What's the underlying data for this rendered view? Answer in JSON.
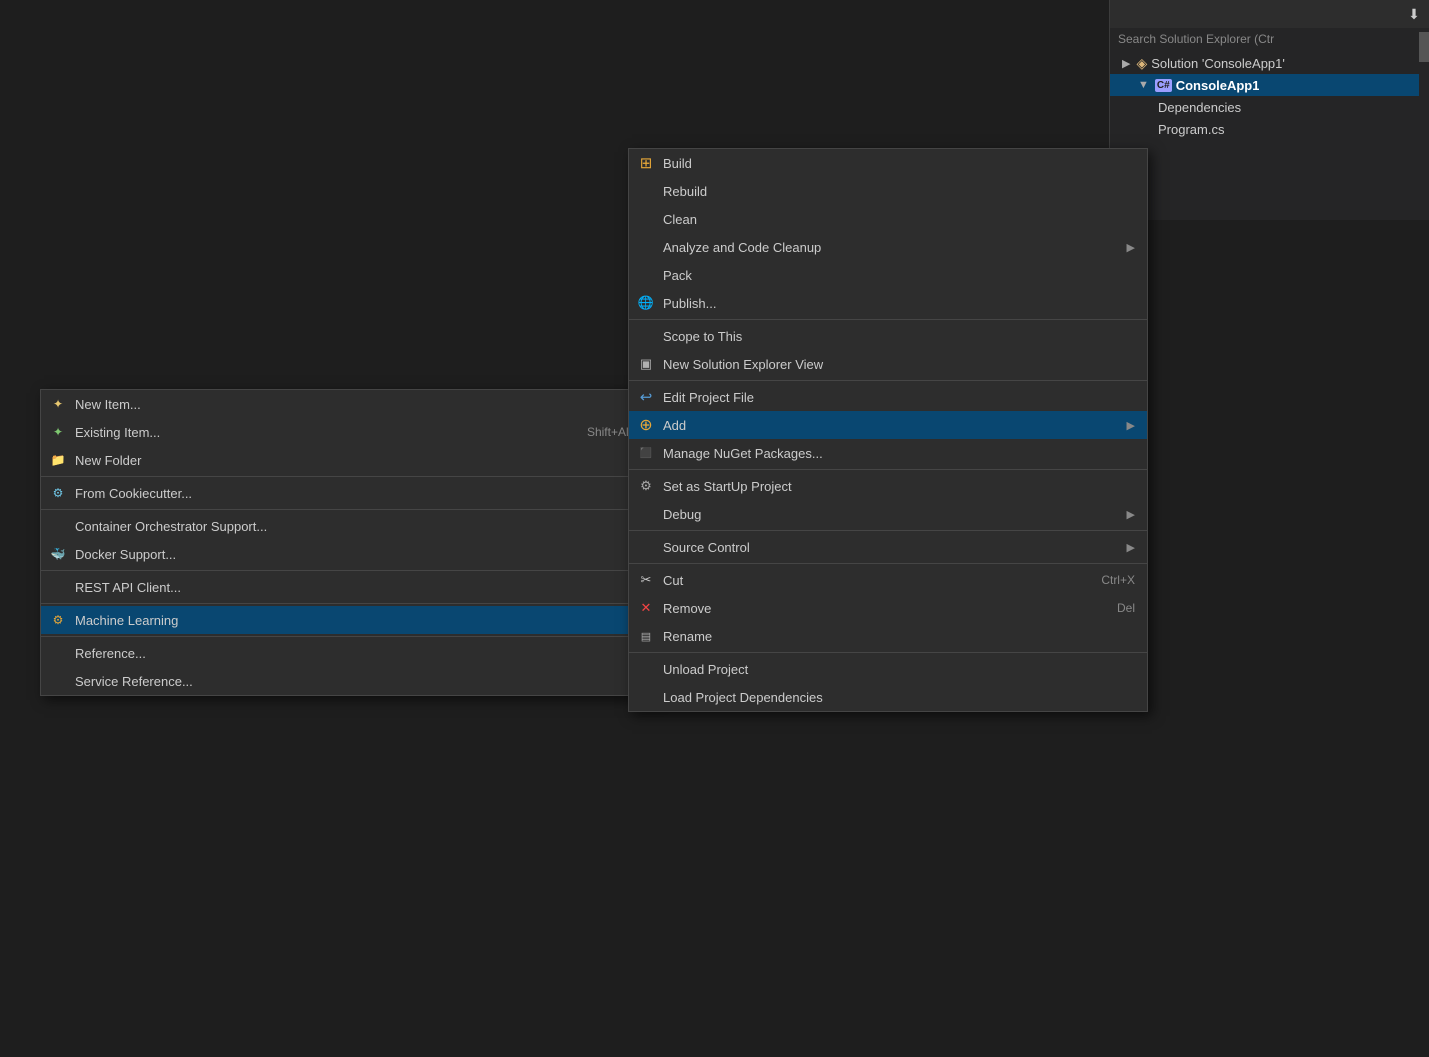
{
  "solution_explorer": {
    "search_placeholder": "Search Solution Explorer (Ctr",
    "tree_items": [
      {
        "id": "solution",
        "indent": 0,
        "icon": "◈",
        "label": "Solution 'ConsoleApp1'",
        "selected": false,
        "has_arrow": true
      },
      {
        "id": "project",
        "indent": 1,
        "icon": "C#",
        "label": "ConsoleApp1",
        "selected": true,
        "has_arrow": true
      },
      {
        "id": "dependencies",
        "indent": 2,
        "icon": "",
        "label": "Dependencies",
        "selected": false
      },
      {
        "id": "program",
        "indent": 2,
        "icon": "",
        "label": "Program.cs",
        "selected": false
      }
    ]
  },
  "context_menu_main": {
    "items": [
      {
        "id": "build",
        "icon": "build",
        "label": "Build",
        "shortcut": "",
        "has_arrow": false,
        "separator_after": false
      },
      {
        "id": "rebuild",
        "icon": "",
        "label": "Rebuild",
        "shortcut": "",
        "has_arrow": false,
        "separator_after": false
      },
      {
        "id": "clean",
        "icon": "",
        "label": "Clean",
        "shortcut": "",
        "has_arrow": false,
        "separator_after": false
      },
      {
        "id": "analyze",
        "icon": "",
        "label": "Analyze and Code Cleanup",
        "shortcut": "",
        "has_arrow": true,
        "separator_after": false
      },
      {
        "id": "pack",
        "icon": "",
        "label": "Pack",
        "shortcut": "",
        "has_arrow": false,
        "separator_after": false
      },
      {
        "id": "publish",
        "icon": "globe",
        "label": "Publish...",
        "shortcut": "",
        "has_arrow": false,
        "separator_after": true
      },
      {
        "id": "scope",
        "icon": "",
        "label": "Scope to This",
        "shortcut": "",
        "has_arrow": false,
        "separator_after": false
      },
      {
        "id": "new-view",
        "icon": "new-view",
        "label": "New Solution Explorer View",
        "shortcut": "",
        "has_arrow": false,
        "separator_after": true
      },
      {
        "id": "edit-project",
        "icon": "edit",
        "label": "Edit Project File",
        "shortcut": "",
        "has_arrow": false,
        "separator_after": false
      },
      {
        "id": "add",
        "icon": "add",
        "label": "Add",
        "shortcut": "",
        "has_arrow": true,
        "separator_after": false,
        "hovered": true
      },
      {
        "id": "nuget",
        "icon": "nuget",
        "label": "Manage NuGet Packages...",
        "shortcut": "",
        "has_arrow": false,
        "separator_after": true
      },
      {
        "id": "startup",
        "icon": "startup",
        "label": "Set as StartUp Project",
        "shortcut": "",
        "has_arrow": false,
        "separator_after": false
      },
      {
        "id": "debug",
        "icon": "",
        "label": "Debug",
        "shortcut": "",
        "has_arrow": true,
        "separator_after": true
      },
      {
        "id": "source-control",
        "icon": "",
        "label": "Source Control",
        "shortcut": "",
        "has_arrow": true,
        "separator_after": true
      },
      {
        "id": "cut",
        "icon": "cut",
        "label": "Cut",
        "shortcut": "Ctrl+X",
        "has_arrow": false,
        "separator_after": false
      },
      {
        "id": "remove",
        "icon": "remove",
        "label": "Remove",
        "shortcut": "Del",
        "has_arrow": false,
        "separator_after": false
      },
      {
        "id": "rename",
        "icon": "rename",
        "label": "Rename",
        "shortcut": "",
        "has_arrow": false,
        "separator_after": true
      },
      {
        "id": "unload",
        "icon": "",
        "label": "Unload Project",
        "shortcut": "",
        "has_arrow": false,
        "separator_after": false
      },
      {
        "id": "load-deps",
        "icon": "",
        "label": "Load Project Dependencies",
        "shortcut": "",
        "has_arrow": false,
        "separator_after": false
      }
    ]
  },
  "context_menu_sub": {
    "items": [
      {
        "id": "new-item",
        "icon": "newitem",
        "label": "New Item...",
        "shortcut": ""
      },
      {
        "id": "existing-item",
        "icon": "existing",
        "label": "Existing Item...",
        "shortcut": "Shift+Alt+A"
      },
      {
        "id": "new-folder",
        "icon": "folder",
        "label": "New Folder",
        "shortcut": ""
      },
      {
        "id": "separator1",
        "type": "separator"
      },
      {
        "id": "cookiecutter",
        "icon": "cookiecutter",
        "label": "From Cookiecutter...",
        "shortcut": ""
      },
      {
        "id": "separator2",
        "type": "separator"
      },
      {
        "id": "container-orch",
        "icon": "",
        "label": "Container Orchestrator Support...",
        "shortcut": ""
      },
      {
        "id": "docker",
        "icon": "docker",
        "label": "Docker Support...",
        "shortcut": ""
      },
      {
        "id": "separator3",
        "type": "separator"
      },
      {
        "id": "rest-api",
        "icon": "",
        "label": "REST API Client...",
        "shortcut": ""
      },
      {
        "id": "separator4",
        "type": "separator"
      },
      {
        "id": "ml",
        "icon": "ml",
        "label": "Machine Learning",
        "shortcut": "",
        "hovered": true
      },
      {
        "id": "separator5",
        "type": "separator"
      },
      {
        "id": "reference",
        "icon": "",
        "label": "Reference...",
        "shortcut": ""
      },
      {
        "id": "service-reference",
        "icon": "",
        "label": "Service Reference...",
        "shortcut": ""
      }
    ]
  }
}
